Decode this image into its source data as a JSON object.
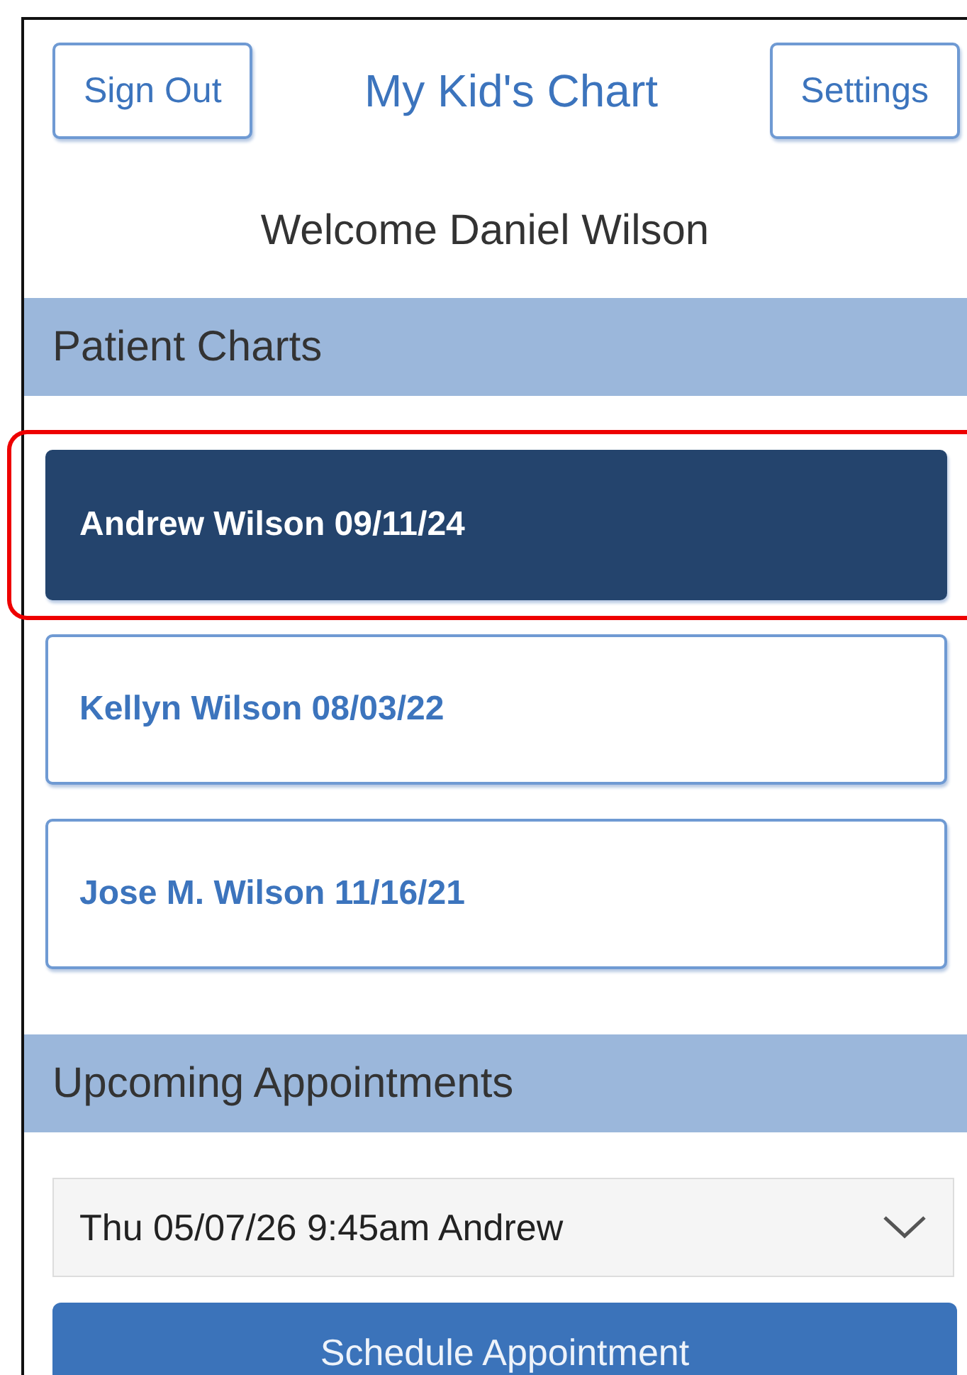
{
  "header": {
    "sign_out": "Sign Out",
    "title": "My Kid's Chart",
    "settings": "Settings"
  },
  "welcome": "Welcome Daniel Wilson",
  "patient_charts": {
    "heading": "Patient Charts",
    "items": [
      {
        "label": "Andrew Wilson 09/11/24",
        "selected": true,
        "highlighted": true
      },
      {
        "label": "Kellyn Wilson 08/03/22",
        "selected": false,
        "highlighted": false
      },
      {
        "label": "Jose M. Wilson 11/16/21",
        "selected": false,
        "highlighted": false
      }
    ]
  },
  "upcoming_appointments": {
    "heading": "Upcoming Appointments",
    "dropdown": {
      "value": "Thu 05/07/26 9:45am Andrew"
    },
    "schedule_button": "Schedule Appointment"
  }
}
